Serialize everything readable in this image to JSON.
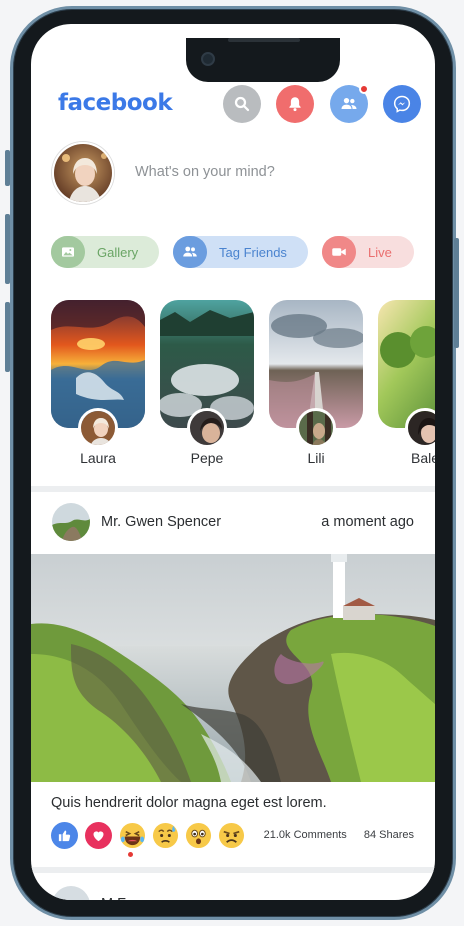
{
  "app": {
    "logo": "facebook"
  },
  "header": {
    "icons": [
      "search-icon",
      "bell-icon",
      "friends-icon",
      "messenger-icon"
    ],
    "colors": {
      "logo": "#3b79e7",
      "search": "#b9bcbf",
      "bell": "#f06d6d",
      "friends": "#76a9ec",
      "messenger": "#4a84e6"
    }
  },
  "composer": {
    "placeholder": "What's on your mind?"
  },
  "actions": [
    {
      "label": "Gallery",
      "icon": "gallery-icon",
      "color": "#6aa565"
    },
    {
      "label": "Tag Friends",
      "icon": "tag-friends-icon",
      "color": "#4a83cf"
    },
    {
      "label": "Live",
      "icon": "video-icon",
      "color": "#ea6e6e"
    }
  ],
  "stories": [
    {
      "name": "Laura"
    },
    {
      "name": "Pepe"
    },
    {
      "name": "Lili"
    },
    {
      "name": "Bale"
    }
  ],
  "post": {
    "author": "Mr. Gwen Spencer",
    "time": "a moment ago",
    "caption": "Quis hendrerit dolor magna eget est lorem.",
    "reactions": [
      "like-icon",
      "love-icon",
      "haha-icon",
      "sad-icon",
      "wow-icon",
      "angry-icon"
    ],
    "comments": "21.0k Comments",
    "shares": "84 Shares"
  },
  "next_post": {
    "author": "M     F"
  }
}
